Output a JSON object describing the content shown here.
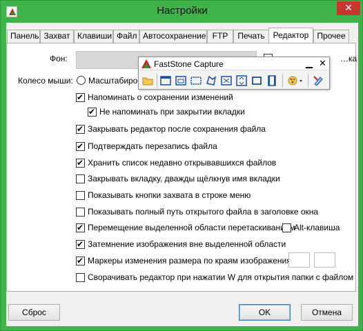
{
  "window": {
    "title": "Настройки",
    "close_glyph": "✕"
  },
  "tabs": [
    "Панель",
    "Захват",
    "Клавиши",
    "Файл",
    "Автосохранение",
    "FTP",
    "Печать",
    "Редактор",
    "Прочее"
  ],
  "active_tab": "Редактор",
  "editor": {
    "background_label": "Фон:",
    "background_checkbox_label": "…ка",
    "mouse_wheel_label": "Колесо мыши:",
    "mouse_wheel_option": "Масштабирова",
    "options": [
      {
        "label": "Напоминать о сохранении изменений",
        "checked": true
      },
      {
        "label": "Не напоминать при закрытии вкладки",
        "checked": true
      },
      {
        "label": "Закрывать редактор после сохранения файла",
        "checked": true
      },
      {
        "label": "Подтверждать перезапись файла",
        "checked": true
      },
      {
        "label": "Хранить список недавно открывавшихся файлов",
        "checked": true
      },
      {
        "label": "Закрывать вкладку, дважды щёлкнув имя вкладки",
        "checked": false
      },
      {
        "label": "Показывать кнопки захвата в строке меню",
        "checked": false
      },
      {
        "label": "Показывать полный путь открытого файла в заголовке окна",
        "checked": false
      },
      {
        "label": "Перемещение выделенной области перетаскиванием",
        "checked": true
      },
      {
        "label": "Затемнение изображения вне выделенной области",
        "checked": true
      },
      {
        "label": "Маркеры изменения размера по краям изображения",
        "checked": true
      },
      {
        "label": "Сворачивать редактор при нажатии W для открытия папки с файлом",
        "checked": false
      }
    ],
    "alt_key_label": "Alt-клавиша",
    "alt_key_checked": false
  },
  "faststone": {
    "title": "FastStone Capture",
    "min_glyph": "▁",
    "close_glyph": "✕",
    "tools": [
      "open-folder-icon",
      "capture-active-window-icon",
      "capture-window-object-icon",
      "capture-rectangle-icon",
      "capture-freehand-icon",
      "capture-fullscreen-icon",
      "capture-scrolling-icon",
      "capture-fixed-region-icon",
      "capture-video-icon",
      "output-palette-icon",
      "settings-icon"
    ]
  },
  "buttons": {
    "reset": "Сброс",
    "ok": "OK",
    "cancel": "Отмена"
  }
}
